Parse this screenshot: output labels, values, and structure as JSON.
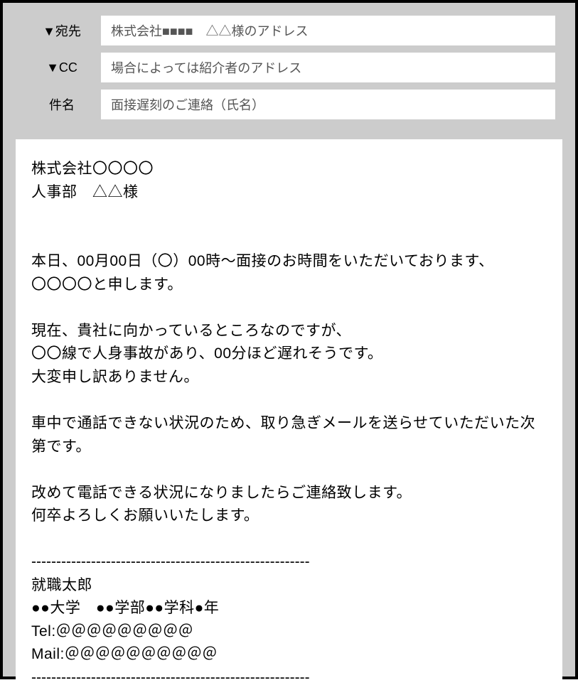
{
  "header": {
    "to_label": "▼宛先",
    "to_value": "株式会社■■■■　△△様のアドレス",
    "cc_label": "▼CC",
    "cc_value": "場合によっては紹介者のアドレス",
    "subject_label": "件名",
    "subject_value": "面接遅刻のご連絡（氏名）"
  },
  "body": {
    "greeting1": "株式会社〇〇〇〇",
    "greeting2": "人事部　△△様",
    "para1_l1": "本日、00月00日（〇）00時〜面接のお時間をいただいております、",
    "para1_l2": "〇〇〇〇と申します。",
    "para2_l1": "現在、貴社に向かっているところなのですが、",
    "para2_l2": "〇〇線で人身事故があり、00分ほど遅れそうです。",
    "para2_l3": "大変申し訳ありません。",
    "para3_l1": "車中で通話できない状況のため、取り急ぎメールを送らせていただいた次第です。",
    "para4_l1": "改めて電話できる状況になりましたらご連絡致します。",
    "para4_l2": "何卒よろしくお願いいたします。",
    "sig_div": "--------------------------------------------------------",
    "sig_name": "就職太郎",
    "sig_school": "●●大学　●●学部●●学科●年",
    "sig_tel": "Tel:＠＠＠＠＠＠＠＠＠",
    "sig_mail": "Mail:＠＠＠＠＠＠＠＠＠＠",
    "sig_div2": "--------------------------------------------------------"
  }
}
